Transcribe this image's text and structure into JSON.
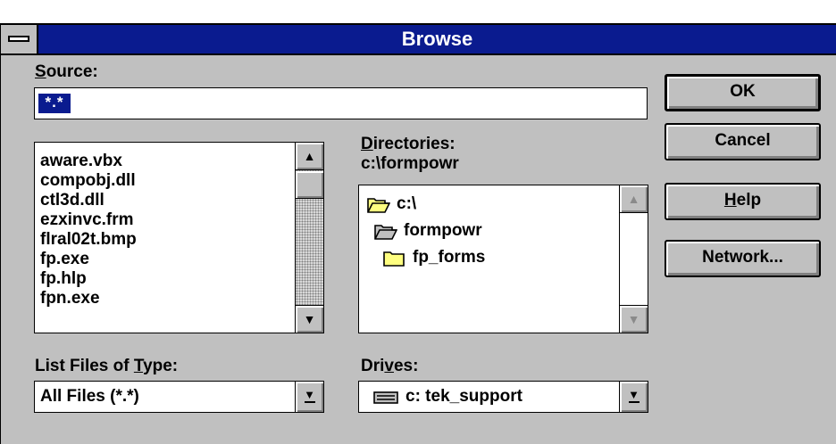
{
  "window": {
    "title": "Browse"
  },
  "source": {
    "label": "Source:",
    "label_key": "S",
    "label_rest": "ource:",
    "value": "*.*"
  },
  "buttons": {
    "ok": "OK",
    "cancel": "Cancel",
    "help_key": "H",
    "help_rest": "elp",
    "network": "Network..."
  },
  "files": {
    "items": [
      "aware.vbx",
      "compobj.dll",
      "ctl3d.dll",
      "ezxinvc.frm",
      "flral02t.bmp",
      "fp.exe",
      "fp.hlp",
      "fpn.exe"
    ]
  },
  "directories": {
    "label_key": "D",
    "label_rest": "irectories:",
    "current_path": "c:\\formpowr",
    "items": [
      {
        "name": "c:\\",
        "icon": "open-folder-icon"
      },
      {
        "name": "formpowr",
        "icon": "open-folder-icon"
      },
      {
        "name": "fp_forms",
        "icon": "closed-folder-icon"
      }
    ]
  },
  "file_type": {
    "label_pre": "List Files of ",
    "label_key": "T",
    "label_rest": "ype:",
    "selected": "All Files (*.*)"
  },
  "drives": {
    "label_pre": "Dri",
    "label_key": "v",
    "label_rest": "es:",
    "selected": "c: tek_support",
    "icon": "drive-icon"
  }
}
